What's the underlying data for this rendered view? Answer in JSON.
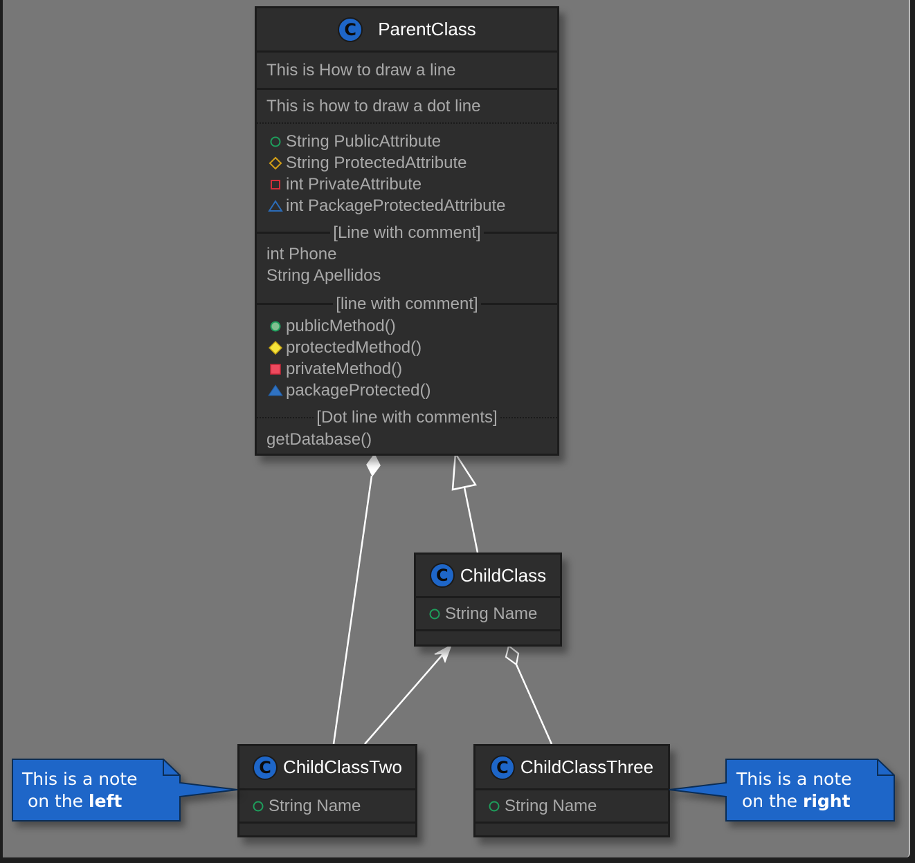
{
  "diagram": {
    "colors": {
      "canvas": "#777777",
      "class_fill": "#2d2d2d",
      "class_border": "#1c1c1c",
      "class_icon": "#1e66c8",
      "note_fill": "#1e66c8",
      "note_border": "#0b2d55",
      "public": "#1e9e5c",
      "protected": "#d4a017",
      "private": "#d32f3a",
      "package": "#2b6cb8",
      "edge": "#ffffff"
    },
    "classes": {
      "parent": {
        "stereotype_icon": "C",
        "name": "ParentClass",
        "line_section_text": "This is How to draw a line",
        "dot_section_text": "This is how to draw a dot line",
        "attributes": [
          {
            "visibility": "public",
            "text": "String PublicAttribute"
          },
          {
            "visibility": "protected",
            "text": "String ProtectedAttribute"
          },
          {
            "visibility": "private",
            "text": "int PrivateAttribute"
          },
          {
            "visibility": "package",
            "text": "int PackageProtectedAttribute"
          }
        ],
        "separator_1_label": "[Line with comment]",
        "plain_fields": [
          "int Phone",
          "String Apellidos"
        ],
        "separator_2_label": "[line with comment]",
        "methods": [
          {
            "visibility": "public",
            "text": "publicMethod()"
          },
          {
            "visibility": "protected",
            "text": "protectedMethod()"
          },
          {
            "visibility": "private",
            "text": "privateMethod()"
          },
          {
            "visibility": "package",
            "text": "packageProtected()"
          }
        ],
        "separator_3_label": "[Dot line with comments]",
        "last_method": "getDatabase()"
      },
      "child": {
        "stereotype_icon": "C",
        "name": "ChildClass",
        "attributes": [
          {
            "visibility": "public",
            "text": "String Name"
          }
        ]
      },
      "child_two": {
        "stereotype_icon": "C",
        "name": "ChildClassTwo",
        "attributes": [
          {
            "visibility": "public",
            "text": "String Name"
          }
        ]
      },
      "child_three": {
        "stereotype_icon": "C",
        "name": "ChildClassThree",
        "attributes": [
          {
            "visibility": "public",
            "text": "String Name"
          }
        ]
      }
    },
    "notes": {
      "left": {
        "line1": "This is a note",
        "line2_prefix": " on the ",
        "line2_bold": "left"
      },
      "right": {
        "line1": "This is a note",
        "line2_prefix": "on the ",
        "line2_bold": "right"
      }
    },
    "relations": [
      {
        "from": "ChildClassTwo",
        "to": "ParentClass",
        "type": "composition"
      },
      {
        "from": "ChildClass",
        "to": "ParentClass",
        "type": "inheritance"
      },
      {
        "from": "ChildClassTwo",
        "to": "ChildClass",
        "type": "association-arrow"
      },
      {
        "from": "ChildClassThree",
        "to": "ChildClass",
        "type": "aggregation"
      }
    ]
  }
}
